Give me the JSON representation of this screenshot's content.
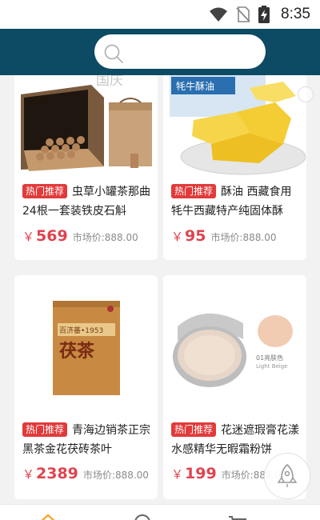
{
  "status_bar": {
    "time": "8:35",
    "icons": [
      "wifi-icon",
      "no-sim-icon",
      "battery-charging-icon"
    ]
  },
  "search": {
    "placeholder": "",
    "icon": "search-icon"
  },
  "products": [
    {
      "tag": "热门推荐",
      "title": "虫草小罐茶那曲24根一套装铁皮石斛",
      "currency": "￥",
      "price": "569",
      "market_price": "市场价:888.00",
      "image_caption": "国庆"
    },
    {
      "tag": "热门推荐",
      "title": "酥油 西藏食用牦牛西藏特产纯固体酥",
      "currency": "￥",
      "price": "95",
      "market_price": "市场价:888.00",
      "image_caption": "牦牛酥油"
    },
    {
      "tag": "热门推荐",
      "title": "青海边销茶正宗黑茶金花茯砖茶叶",
      "currency": "￥",
      "price": "2389",
      "market_price": "市场价:888.00",
      "image_brand": "百济蕃•1953",
      "image_caption": "茯茶"
    },
    {
      "tag": "热门推荐",
      "title": "花迷遮瑕膏花漾水感精华无暇霜粉饼",
      "currency": "￥",
      "price": "199",
      "market_price": "市场价:888.00",
      "image_caption": "01亮肤色",
      "image_subcaption": "Light Beige"
    }
  ],
  "floating_button": {
    "icon": "rocket-icon"
  },
  "tab_bar": {
    "icons": [
      "home-icon",
      "search-icon",
      "cart-icon"
    ]
  },
  "colors": {
    "header": "#0d4a63",
    "accent": "#e0444e",
    "tag": "#e23a3a"
  }
}
